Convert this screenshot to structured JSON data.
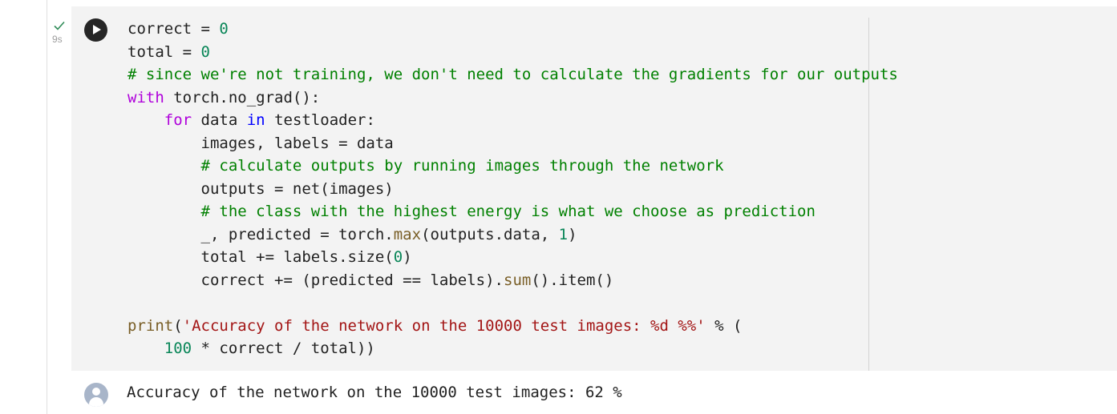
{
  "gutter": {
    "status_icon": "check-icon",
    "exec_time": "9s"
  },
  "run_button": {
    "icon": "play-icon"
  },
  "code_lines": [
    [
      {
        "t": "correct = ",
        "c": ""
      },
      {
        "t": "0",
        "c": "num"
      }
    ],
    [
      {
        "t": "total = ",
        "c": ""
      },
      {
        "t": "0",
        "c": "num"
      }
    ],
    [
      {
        "t": "# since we're not training, we don't need to calculate the gradients for our outputs",
        "c": "cm"
      }
    ],
    [
      {
        "t": "with",
        "c": "kw"
      },
      {
        "t": " torch.no_grad():",
        "c": ""
      }
    ],
    [
      {
        "t": "    ",
        "c": ""
      },
      {
        "t": "for",
        "c": "kw"
      },
      {
        "t": " data ",
        "c": ""
      },
      {
        "t": "in",
        "c": "kb"
      },
      {
        "t": " testloader:",
        "c": ""
      }
    ],
    [
      {
        "t": "        images, labels = data",
        "c": ""
      }
    ],
    [
      {
        "t": "        ",
        "c": ""
      },
      {
        "t": "# calculate outputs by running images through the network",
        "c": "cm"
      }
    ],
    [
      {
        "t": "        outputs = net(images)",
        "c": ""
      }
    ],
    [
      {
        "t": "        ",
        "c": ""
      },
      {
        "t": "# the class with the highest energy is what we choose as prediction",
        "c": "cm"
      }
    ],
    [
      {
        "t": "        _, predicted = torch.",
        "c": ""
      },
      {
        "t": "max",
        "c": "fn"
      },
      {
        "t": "(outputs.data, ",
        "c": ""
      },
      {
        "t": "1",
        "c": "num"
      },
      {
        "t": ")",
        "c": ""
      }
    ],
    [
      {
        "t": "        total += labels.size(",
        "c": ""
      },
      {
        "t": "0",
        "c": "num"
      },
      {
        "t": ")",
        "c": ""
      }
    ],
    [
      {
        "t": "        correct += (predicted == labels).",
        "c": ""
      },
      {
        "t": "sum",
        "c": "fn"
      },
      {
        "t": "().item()",
        "c": ""
      }
    ],
    [],
    [
      {
        "t": "print",
        "c": "fn"
      },
      {
        "t": "(",
        "c": ""
      },
      {
        "t": "'Accuracy of the network on the 10000 test images: %d %%'",
        "c": "str"
      },
      {
        "t": " % (",
        "c": ""
      }
    ],
    [
      {
        "t": "    ",
        "c": ""
      },
      {
        "t": "100",
        "c": "num"
      },
      {
        "t": " * correct / total))",
        "c": ""
      }
    ]
  ],
  "output": {
    "avatar_icon": "user-avatar-icon",
    "text": "Accuracy of the network on the 10000 test images: 62 %"
  }
}
